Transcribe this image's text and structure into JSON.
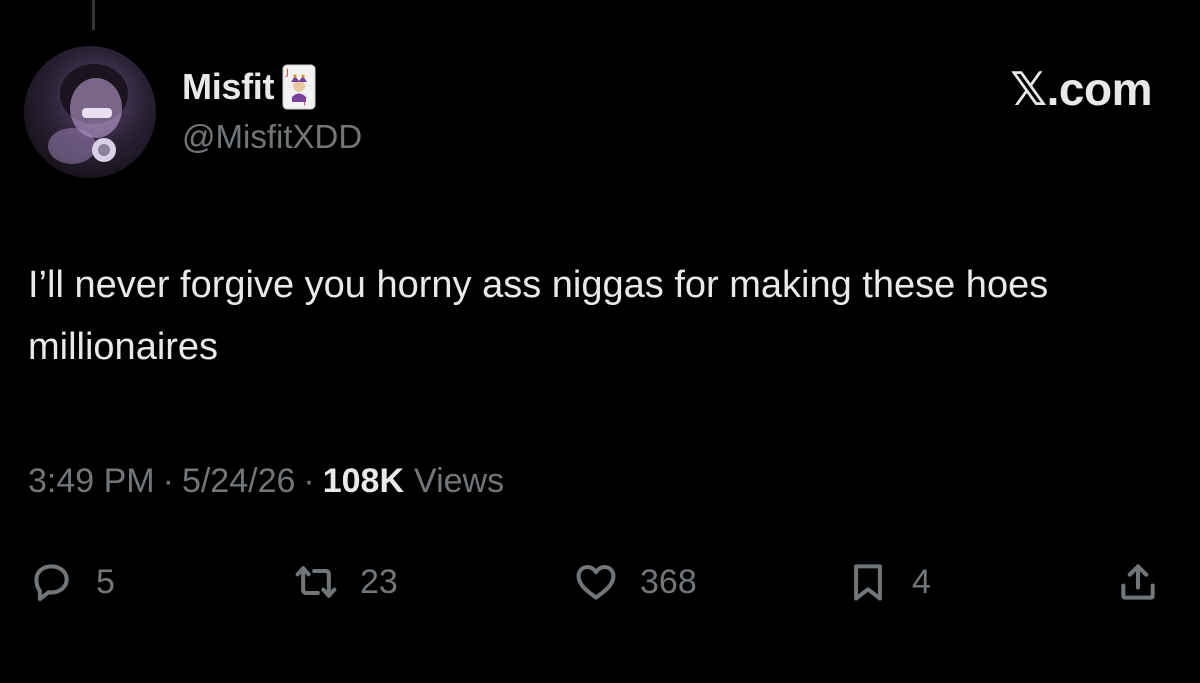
{
  "author": {
    "display_name": "Misfit",
    "handle": "@MisfitXDD",
    "badge_icon": "jack-playing-card-icon"
  },
  "watermark": "𝕏.com",
  "tweet": {
    "text": "I’ll never forgive you horny ass niggas for making these hoes millionaires"
  },
  "meta": {
    "time": "3:49 PM",
    "separator": "·",
    "date": "5/24/26",
    "views_count": "108K",
    "views_label": "Views"
  },
  "actions": {
    "reply": {
      "icon": "reply-icon",
      "count": "5"
    },
    "retweet": {
      "icon": "retweet-icon",
      "count": "23"
    },
    "like": {
      "icon": "heart-icon",
      "count": "368"
    },
    "bookmark": {
      "icon": "bookmark-icon",
      "count": "4"
    },
    "share": {
      "icon": "share-icon"
    }
  },
  "colors": {
    "background": "#000000",
    "primary_text": "#e7e9ea",
    "secondary_text": "#71767b"
  }
}
